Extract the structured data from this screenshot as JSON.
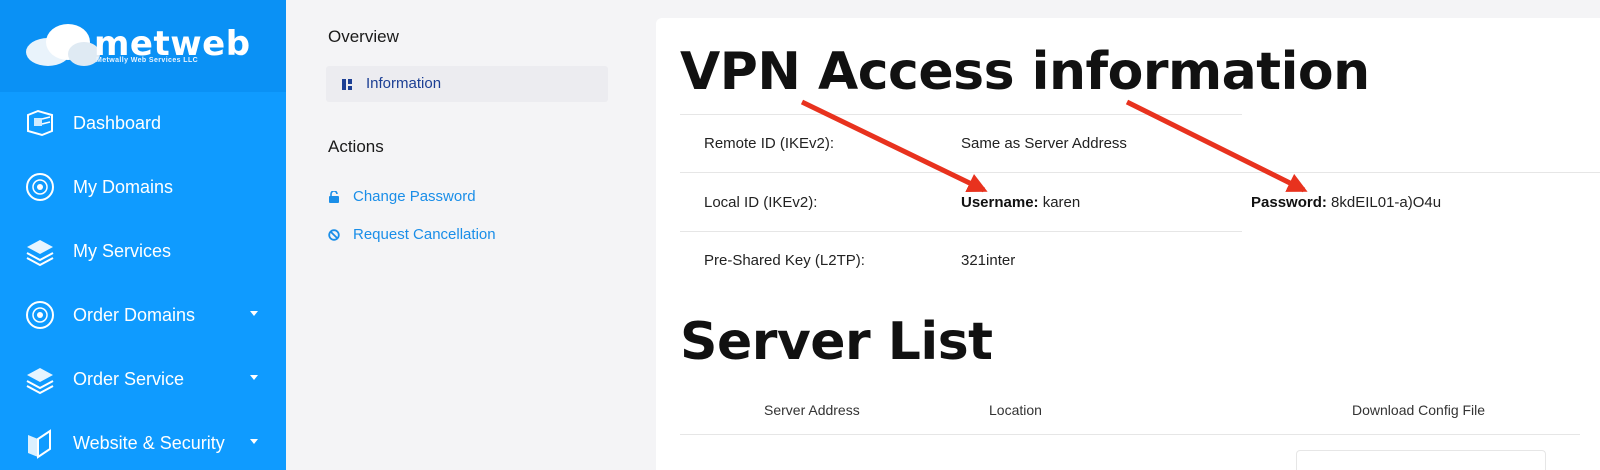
{
  "brand": {
    "name": "metweb",
    "tagline": "Metwally Web Services LLC"
  },
  "sidebar": {
    "items": [
      {
        "label": "Dashboard",
        "icon": "dashboard-icon",
        "has_caret": false
      },
      {
        "label": "My Domains",
        "icon": "globe-icon",
        "has_caret": false
      },
      {
        "label": "My Services",
        "icon": "layers-icon",
        "has_caret": false
      },
      {
        "label": "Order Domains",
        "icon": "globe-icon",
        "has_caret": true
      },
      {
        "label": "Order Service",
        "icon": "layers-icon",
        "has_caret": true
      },
      {
        "label": "Website & Security",
        "icon": "shield-icon",
        "has_caret": true
      }
    ]
  },
  "overview": {
    "heading": "Overview",
    "item": "Information"
  },
  "actions": {
    "heading": "Actions",
    "change_password": "Change Password",
    "request_cancellation": "Request Cancellation"
  },
  "vpn": {
    "title": "VPN Access information",
    "remote_id_label": "Remote ID (IKEv2):",
    "remote_id_value": "Same as Server Address",
    "local_id_label": "Local ID (IKEv2):",
    "username_label": "Username:",
    "username_value": "karen",
    "password_label": "Password:",
    "password_value": "8kdEIL01-a)O4u",
    "psk_label": "Pre-Shared Key (L2TP):",
    "psk_value": "321inter"
  },
  "server_list": {
    "title": "Server List",
    "columns": [
      "Server Address",
      "Location",
      "Download Config File"
    ]
  },
  "colors": {
    "sidebar": "#0f9bff",
    "accent_link": "#1a8ee8",
    "annotation_arrow": "#e8321e"
  }
}
